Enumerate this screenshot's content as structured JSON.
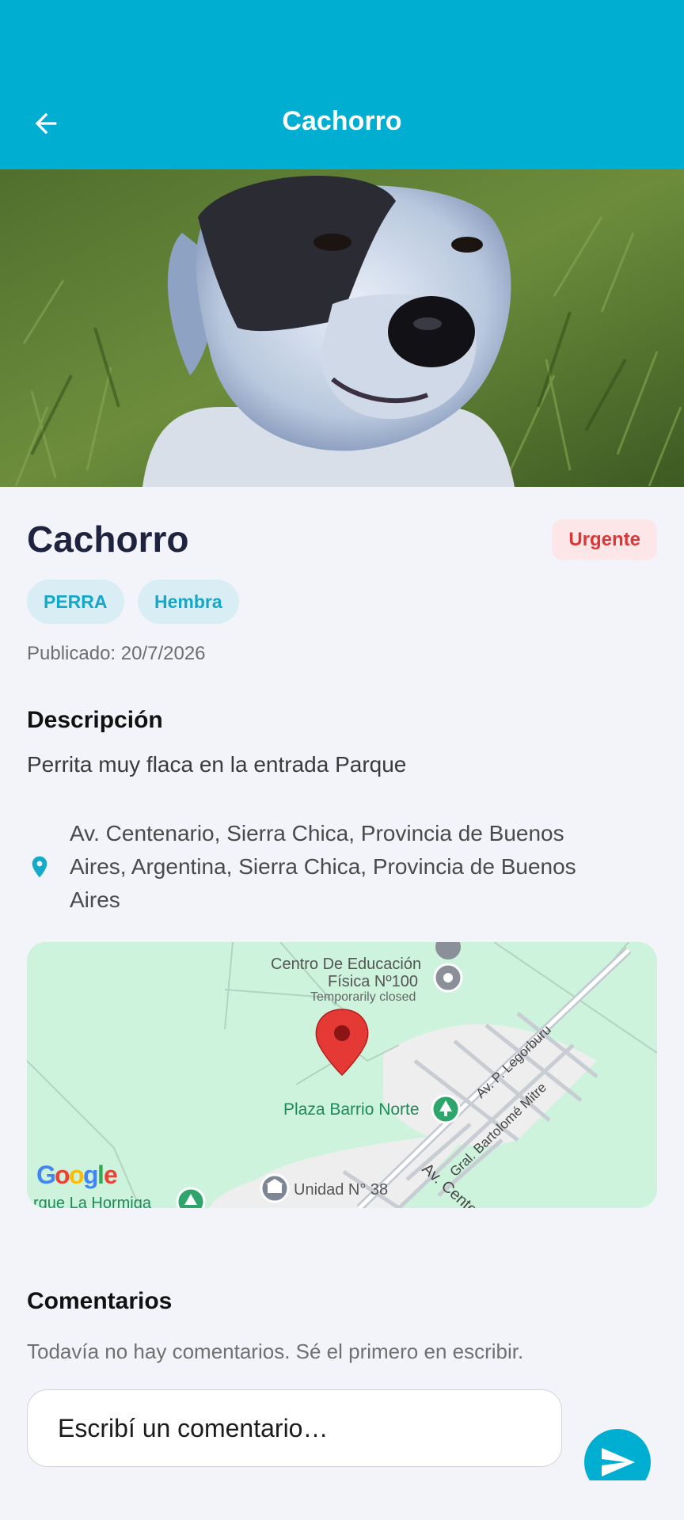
{
  "appbar": {
    "title": "Cachorro"
  },
  "pet": {
    "name": "Cachorro",
    "badge": "Urgente",
    "chips": [
      "PERRA",
      "Hembra"
    ],
    "published": "Publicado: 20/7/2026"
  },
  "description": {
    "heading": "Descripción",
    "text": "Perrita muy flaca en la entrada Parque"
  },
  "location": {
    "line1": "Av. Centenario, Sierra Chica, Provincia de Buenos",
    "line2": "Aires, Argentina, Sierra Chica, Provincia de Buenos",
    "line3": "Aires"
  },
  "map": {
    "poi1_line1": "Centro De Educación",
    "poi1_line2": "Física Nº100",
    "poi1_status": "Temporarily closed",
    "poi2": "Plaza Barrio Norte",
    "poi3": "Unidad N° 38",
    "poi4": "rque La Hormiga",
    "street1": "Av. P. Legorburu",
    "street2": "Gral. Bartolomé Mitre",
    "street3": "Av. Cente",
    "attribution": "Google"
  },
  "comments": {
    "heading": "Comentarios",
    "empty": "Todavía no hay comentarios. Sé el primero en escribir.",
    "placeholder": "Escribí un comentario…"
  },
  "colors": {
    "primary": "#00aed1",
    "urgent_text": "#d93838",
    "urgent_bg": "#fde6e8",
    "chip_bg": "#d8eef4",
    "background": "#f3f4f9"
  }
}
